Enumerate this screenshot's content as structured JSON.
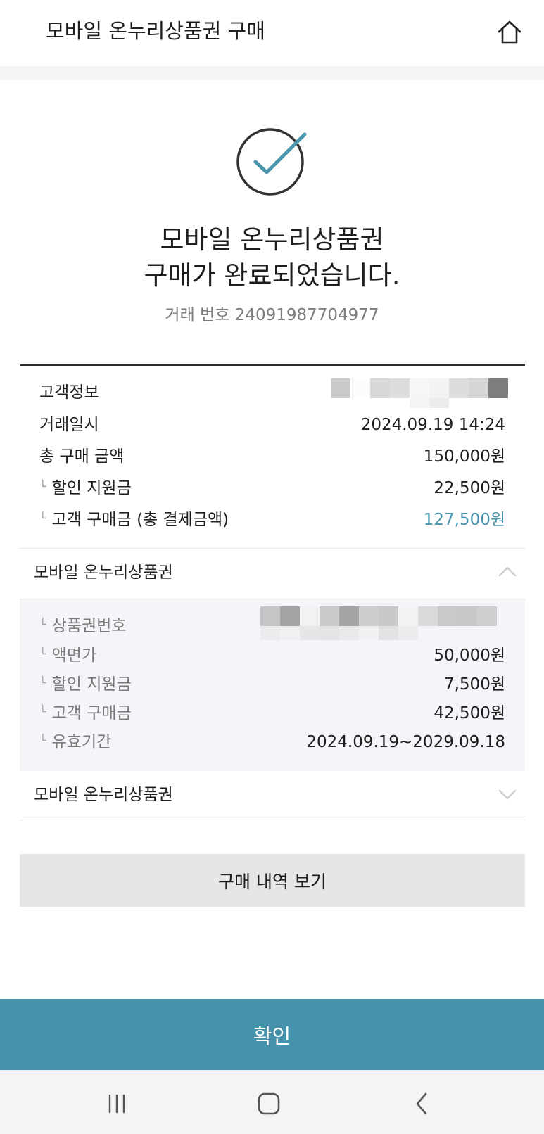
{
  "header": {
    "title": "모바일 온누리상품권 구매",
    "home_icon": "home-icon"
  },
  "result": {
    "icon": "check-circle-icon",
    "title_line1": "모바일 온누리상품권",
    "title_line2": "구매가 완료되었습니다.",
    "transaction_no": "거래 번호 24091987704977"
  },
  "summary": {
    "customer_label": "고객정보",
    "datetime_label": "거래일시",
    "datetime_value": "2024.09.19 14:24",
    "total_label": "총 구매 금액",
    "total_value": "150,000원",
    "discount_label": "할인 지원금",
    "discount_value": "22,500원",
    "customer_pay_label": "고객 구매금 (총 결제금액)",
    "customer_pay_value": "127,500원"
  },
  "sections": [
    {
      "title": "모바일 온누리상품권",
      "expanded": true,
      "chevron": "chevron-up-icon",
      "details": {
        "voucher_no_label": "상품권번호",
        "face_value_label": "액면가",
        "face_value": "50,000원",
        "discount_label": "할인 지원금",
        "discount_value": "7,500원",
        "customer_pay_label": "고객 구매금",
        "customer_pay_value": "42,500원",
        "validity_label": "유효기간",
        "validity_value": "2024.09.19~2029.09.18"
      }
    },
    {
      "title": "모바일 온누리상품권",
      "expanded": false,
      "chevron": "chevron-down-icon"
    }
  ],
  "buttons": {
    "history": "구매 내역 보기",
    "confirm": "확인"
  },
  "nav": {
    "recent": "recent-apps-icon",
    "home": "home-nav-icon",
    "back": "back-icon"
  },
  "colors": {
    "accent": "#4592ad",
    "accent_text": "#4a93ad",
    "detail_bg": "#f5f5f9",
    "button_gray": "#e6e6e6"
  }
}
